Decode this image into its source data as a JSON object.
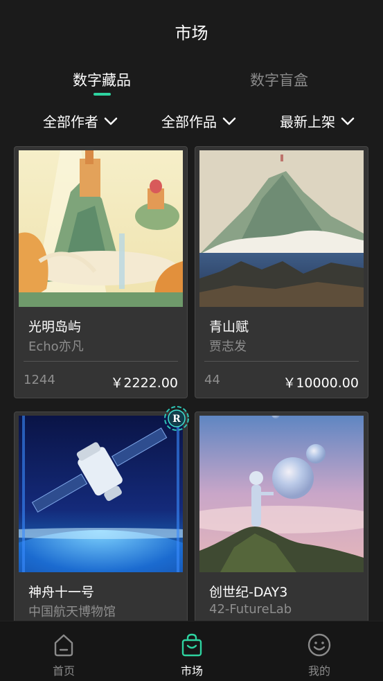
{
  "header": {
    "title": "市场"
  },
  "tabs": [
    {
      "label": "数字藏品",
      "active": true
    },
    {
      "label": "数字盲盒",
      "active": false
    }
  ],
  "accent_color": "#2ed3a0",
  "filters": [
    {
      "label": "全部作者",
      "icon": "chevron-down-icon"
    },
    {
      "label": "全部作品",
      "icon": "chevron-down-icon"
    },
    {
      "label": "最新上架",
      "icon": "chevron-down-icon"
    }
  ],
  "cards": [
    {
      "name": "光明岛屿",
      "author": "Echo亦凡",
      "count": "1244",
      "price": "￥2222.00"
    },
    {
      "name": "青山赋",
      "author": "贾志发",
      "count": "44",
      "price": "￥10000.00"
    },
    {
      "name": "神舟十一号",
      "author": "中国航天博物馆"
    },
    {
      "name": "创世纪-DAY3",
      "author": "42-FutureLab"
    }
  ],
  "badge": {
    "text": "R"
  },
  "bottom_nav": [
    {
      "label": "首页",
      "icon": "home-icon",
      "active": false
    },
    {
      "label": "市场",
      "icon": "shopping-bag-icon",
      "active": true
    },
    {
      "label": "我的",
      "icon": "smiley-icon",
      "active": false
    }
  ]
}
